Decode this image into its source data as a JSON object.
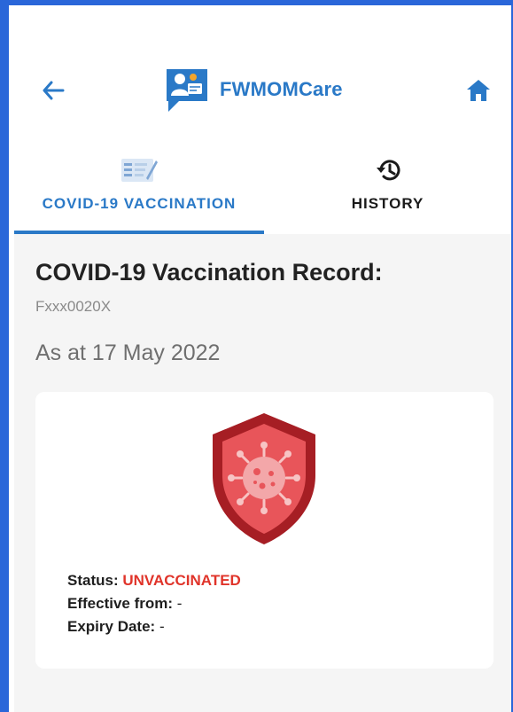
{
  "header": {
    "app_name": "FWMOMCare",
    "back_icon": "arrow-left-icon",
    "home_icon": "home-icon",
    "logo_icon": "fwmomcare-logo-icon",
    "brand_color": "#2a79c7"
  },
  "tabs": [
    {
      "label": "COVID-19 VACCINATION",
      "icon": "vaccination-record-icon",
      "active": true
    },
    {
      "label": "HISTORY",
      "icon": "history-icon",
      "active": false
    }
  ],
  "record": {
    "title": "COVID-19 Vaccination Record:",
    "id": "Fxxx0020X",
    "as_at": "As at 17 May 2022"
  },
  "status": {
    "icon": "virus-shield-icon",
    "status_label": "Status:",
    "status_value": "UNVACCINATED",
    "effective_label": "Effective from:",
    "effective_value": "-",
    "expiry_label": "Expiry Date:",
    "expiry_value": "-",
    "status_color": "#e0342a"
  }
}
